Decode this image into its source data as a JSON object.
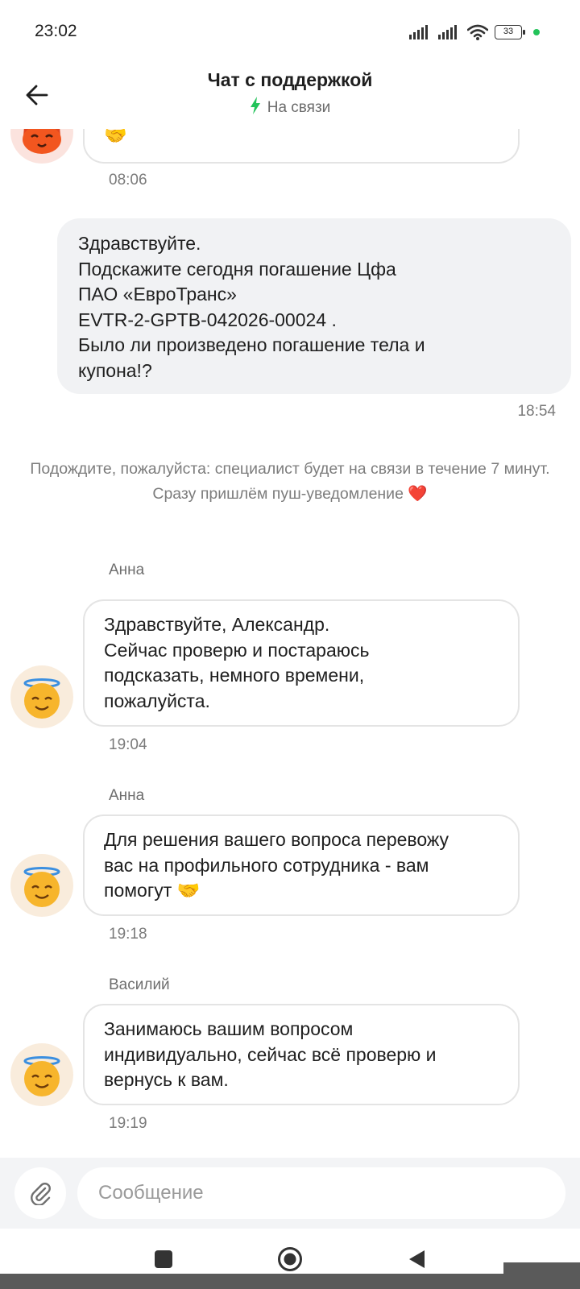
{
  "status_bar": {
    "time": "23:02",
    "battery": "33"
  },
  "header": {
    "title": "Чат с поддержкой",
    "status": "На связи"
  },
  "messages": [
    {
      "type": "incoming",
      "avatar": "fox-emoji",
      "lines": [
        "🤝"
      ],
      "time": "08:06"
    },
    {
      "type": "outgoing",
      "lines": [
        "Здравствуйте.",
        "Подскажите сегодня погашение Цфа",
        "ПАО «ЕвроТранс»",
        "EVTR-2-GPTB-042026-00024 .",
        "Было ли произведено погашение тела и",
        "купона!?"
      ],
      "time": "18:54"
    },
    {
      "type": "system",
      "lines": [
        "Подождите, пожалуйста: специалист будет на связи в течение 7 минут.",
        "Сразу пришлём пуш-уведомление ❤️"
      ]
    },
    {
      "type": "incoming",
      "sender": "Анна",
      "avatar": "angel-emoji",
      "lines": [
        "Здравствуйте, Александр.",
        "Сейчас проверю и постараюсь",
        "подсказать, немного времени,",
        "пожалуйста."
      ],
      "time": "19:04"
    },
    {
      "type": "incoming",
      "sender": "Анна",
      "avatar": "angel-emoji",
      "lines": [
        "Для решения вашего вопроса перевожу",
        "вас на профильного сотрудника - вам",
        "помогут 🤝"
      ],
      "time": "19:18"
    },
    {
      "type": "incoming",
      "sender": "Василий",
      "avatar": "angel-emoji",
      "lines": [
        "Занимаюсь вашим вопросом",
        "индивидуально, сейчас всё проверю и",
        "вернусь к вам."
      ],
      "time": "19:19"
    }
  ],
  "composer": {
    "placeholder": "Сообщение"
  },
  "colors": {
    "accent_green": "#23c35a",
    "bubble_outgoing": "#f1f2f4",
    "bubble_border": "#e4e4e4",
    "heart": "#e23b3b"
  },
  "icons": [
    "back-arrow-icon",
    "lightning-icon",
    "paperclip-icon",
    "recents-square-icon",
    "home-circle-icon",
    "back-triangle-icon"
  ]
}
